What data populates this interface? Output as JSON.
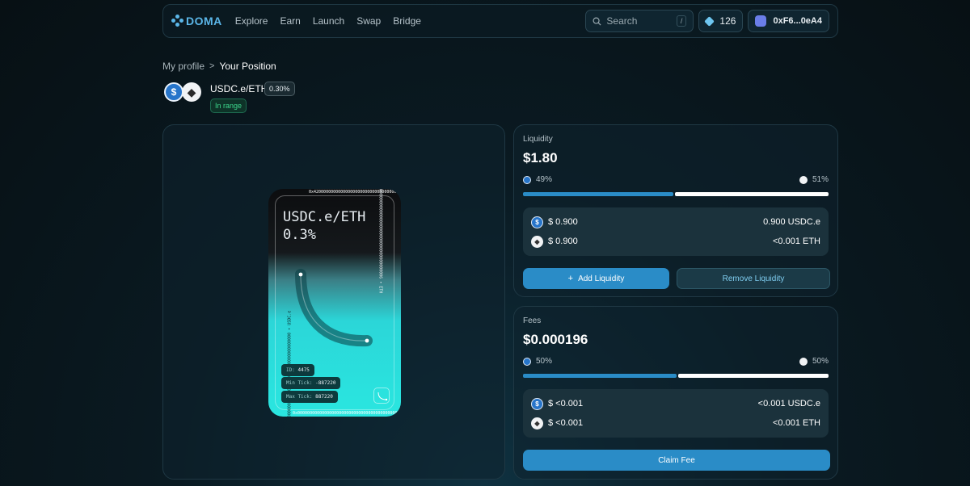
{
  "nav": {
    "logo": "DOMA",
    "links": [
      "Explore",
      "Earn",
      "Launch",
      "Swap",
      "Bridge"
    ],
    "search_placeholder": "Search",
    "search_shortcut": "/",
    "points": "126",
    "wallet_address": "0xF6...0eA4"
  },
  "breadcrumb": {
    "parent": "My profile",
    "separator": ">",
    "current": "Your Position"
  },
  "position": {
    "pair": "USDC.e/ETH",
    "fee_tier": "0.30%",
    "status": "In range"
  },
  "nft": {
    "title_line1": "USDC.e/ETH",
    "title_line2": "0.3%",
    "id_label": "ID:",
    "id_value": "4475",
    "min_tick_label": "Min Tick:",
    "min_tick_value": "-887220",
    "max_tick_label": "Max Tick:",
    "max_tick_value": "887220"
  },
  "liquidity": {
    "label": "Liquidity",
    "amount": "$1.80",
    "left_pct": "49%",
    "right_pct": "51%",
    "left_fraction": 0.49,
    "tokens": [
      {
        "symbol": "USDC.e",
        "usd": "$ 0.900",
        "amount": "0.900 USDC.e"
      },
      {
        "symbol": "ETH",
        "usd": "$ 0.900",
        "amount": "<0.001 ETH"
      }
    ],
    "add_button": "Add Liquidity",
    "remove_button": "Remove Liquidity"
  },
  "fees": {
    "label": "Fees",
    "amount": "$0.000196",
    "left_pct": "50%",
    "right_pct": "50%",
    "left_fraction": 0.5,
    "tokens": [
      {
        "symbol": "USDC.e",
        "usd": "$ <0.001",
        "amount": "<0.001 USDC.e"
      },
      {
        "symbol": "ETH",
        "usd": "$ <0.001",
        "amount": "<0.001 ETH"
      }
    ],
    "claim_button": "Claim Fee"
  },
  "colors": {
    "accent": "#2a8cc7",
    "logo": "#5bb6e8",
    "in_range": "#3dd68c"
  }
}
